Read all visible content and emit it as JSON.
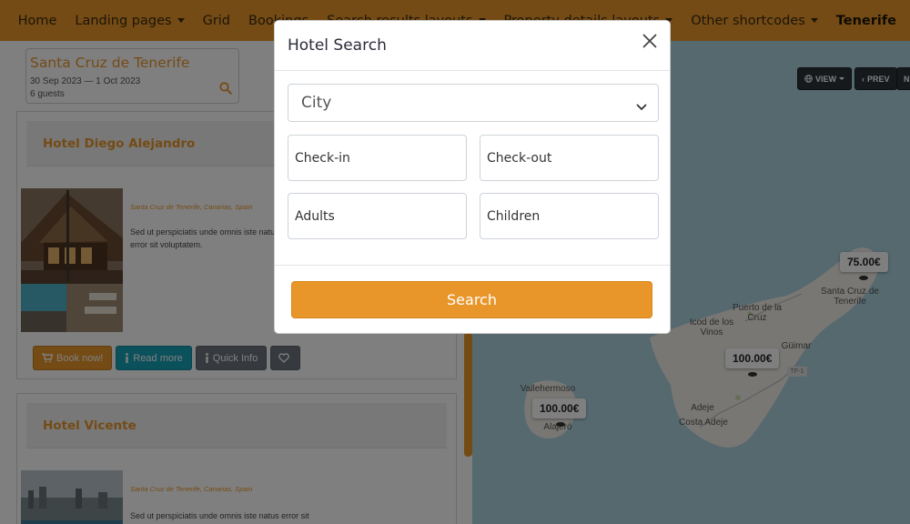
{
  "nav": {
    "items": [
      {
        "label": "Home",
        "dropdown": false
      },
      {
        "label": "Landing pages",
        "dropdown": true
      },
      {
        "label": "Grid",
        "dropdown": false
      },
      {
        "label": "Bookings",
        "dropdown": false
      },
      {
        "label": "Search results layouts",
        "dropdown": true
      },
      {
        "label": "Property details layouts",
        "dropdown": true
      },
      {
        "label": "Other shortcodes",
        "dropdown": true
      }
    ],
    "active": "Tenerife"
  },
  "summary": {
    "city": "Santa Cruz de Tenerife",
    "dates": "30 Sep 2023 — 1 Oct 2023",
    "guests": "6 guests",
    "icon": "search-icon"
  },
  "hotels": [
    {
      "name": "Hotel Diego Alejandro",
      "location": "Santa Cruz de Tenerife, Canarias, Spain",
      "description": "Sed ut perspiciatis unde omnis iste natus error sit voluptatem."
    },
    {
      "name": "Hotel Vicente",
      "location": "Santa Cruz de Tenerife, Canarias, Spain",
      "description": "Sed ut perspiciatis unde omnis iste natus error sit"
    }
  ],
  "buttons": {
    "book": "Book now!",
    "read": "Read more",
    "quick": "Quick Info"
  },
  "map": {
    "view_label": "VIEW",
    "prev_label": "PREV",
    "next_label": "N",
    "places": {
      "santa_cruz": "Santa Cruz de Tenerife",
      "puerto": "Puerto de la Cruz",
      "icod": "Icod de los Vinos",
      "guimar": "Güimar",
      "adeje": "Adeje",
      "costa_adeje": "Costa Adeje",
      "vallehermoso": "Vallehermoso",
      "alajero": "Alajeró",
      "road": "TF-1"
    },
    "prices": {
      "p1": "75.00€",
      "p2": "100.00€",
      "p3": "100.00€"
    }
  },
  "modal": {
    "title": "Hotel Search",
    "city_placeholder": "City",
    "checkin": "Check-in",
    "checkout": "Check-out",
    "adults": "Adults",
    "children": "Children",
    "search": "Search"
  },
  "colors": {
    "accent": "#e8962a",
    "info": "#17a2b8",
    "secondary": "#6c757d",
    "map_water": "#aad3df",
    "map_land": "#f2efe9"
  }
}
